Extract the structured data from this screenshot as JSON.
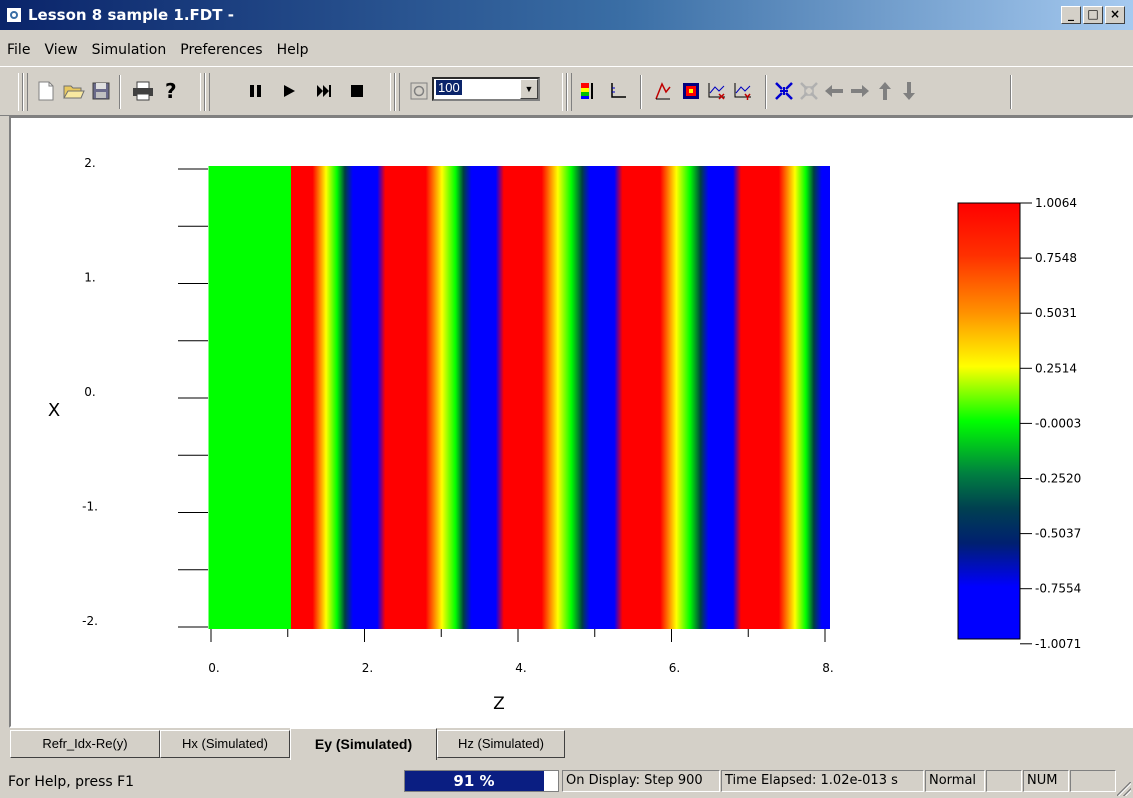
{
  "window": {
    "title": "Lesson 8 sample 1.FDT -"
  },
  "menu": [
    "File",
    "View",
    "Simulation",
    "Preferences",
    "Help"
  ],
  "toolbar": {
    "zoom_value": "100"
  },
  "plot": {
    "x_axis_label": "Z",
    "y_axis_label": "X",
    "x_ticks": [
      "0.",
      "2.",
      "4.",
      "6.",
      "8."
    ],
    "y_ticks": [
      "2.",
      "1.",
      "0.",
      "-1.",
      "-2."
    ],
    "colorbar_ticks": [
      "1.0064",
      "0.7548",
      "0.5031",
      "0.2514",
      "-0.0003",
      "-0.2520",
      "-0.5037",
      "-0.7554",
      "-1.0071"
    ],
    "colors": {
      "high": "#ff0000",
      "mid": "#00ff00",
      "low": "#0000ff"
    }
  },
  "tabs": [
    "Refr_Idx-Re(y)",
    "Hx (Simulated)",
    "Ey (Simulated)",
    "Hz (Simulated)"
  ],
  "active_tab": "Ey (Simulated)",
  "status": {
    "help": "For Help, press F1",
    "progress_text": "91 %",
    "progress_value": 0.91,
    "display": "On Display: Step 900",
    "time": "Time Elapsed: 1.02e-013 s",
    "mode": "Normal",
    "num": "NUM"
  }
}
